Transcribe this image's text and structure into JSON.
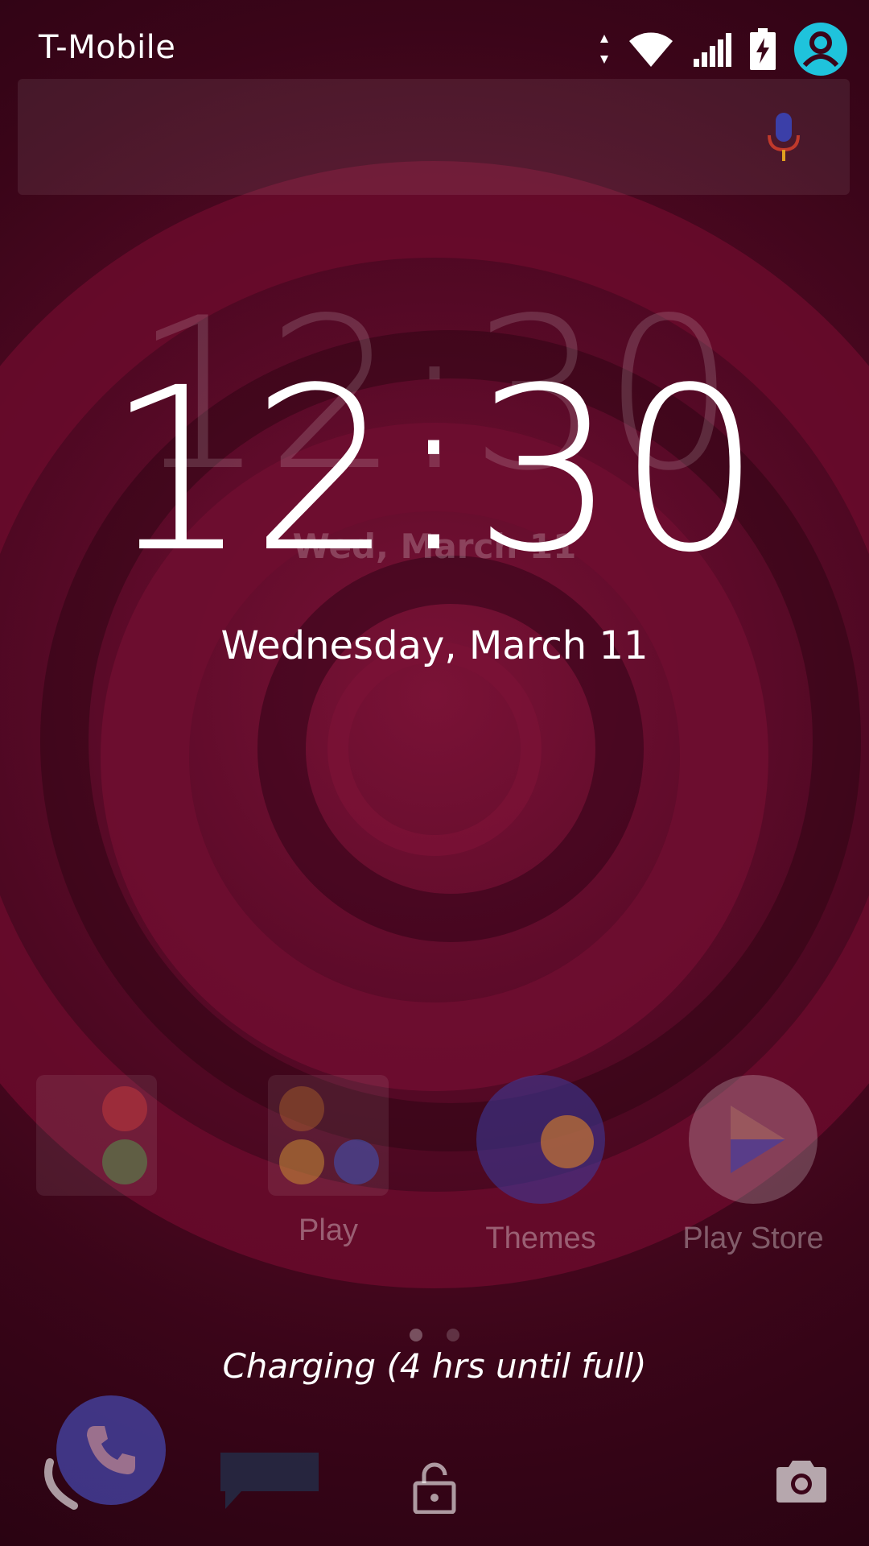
{
  "status_bar": {
    "carrier": "T-Mobile",
    "icons": [
      "data-arrows-icon",
      "wifi-icon",
      "cell-signal-icon",
      "battery-charging-icon",
      "user-avatar-icon"
    ]
  },
  "search_bar": {
    "icon": "mic-icon"
  },
  "ghost_clock": {
    "time": "12:30",
    "date": "Wed, March 11"
  },
  "lockscreen": {
    "time": "12:30",
    "date": "Wednesday, March 11",
    "charging_status": "Charging (4 hrs until full)"
  },
  "home_apps": [
    {
      "label": "",
      "icon": "folder-icon"
    },
    {
      "label": "Play",
      "icon": "play-folder-icon"
    },
    {
      "label": "Themes",
      "icon": "themes-icon"
    },
    {
      "label": "Play Store",
      "icon": "play-store-icon"
    }
  ],
  "page_indicator": {
    "count": 2,
    "active": 0
  },
  "bottom_actions": {
    "phone": "phone-icon",
    "unlock": "lock-icon",
    "camera": "camera-icon"
  },
  "colors": {
    "wallpaper_primary": "#6b0d2f",
    "wallpaper_dark": "#2a0312",
    "accent_avatar": "#1fc3dc",
    "phone_button": "#4646aa"
  }
}
